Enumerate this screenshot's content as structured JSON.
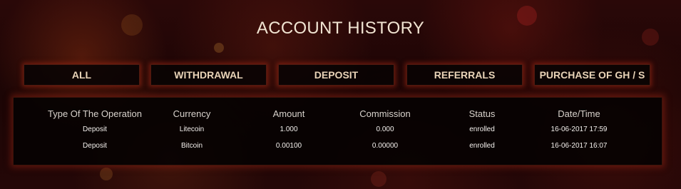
{
  "page": {
    "title": "ACCOUNT HISTORY"
  },
  "tabs": [
    {
      "label": "ALL"
    },
    {
      "label": "WITHDRAWAL"
    },
    {
      "label": "DEPOSIT"
    },
    {
      "label": "REFERRALS"
    },
    {
      "label": "PURCHASE OF GH / S"
    }
  ],
  "table": {
    "headers": [
      "Type Of The Operation",
      "Currency",
      "Amount",
      "Commission",
      "Status",
      "Date/Time"
    ],
    "rows": [
      [
        "Deposit",
        "Litecoin",
        "1.000",
        "0.000",
        "enrolled",
        "16-06-2017 17:59"
      ],
      [
        "Deposit",
        "Bitcoin",
        "0.00100",
        "0.00000",
        "enrolled",
        "16-06-2017 16:07"
      ]
    ]
  }
}
